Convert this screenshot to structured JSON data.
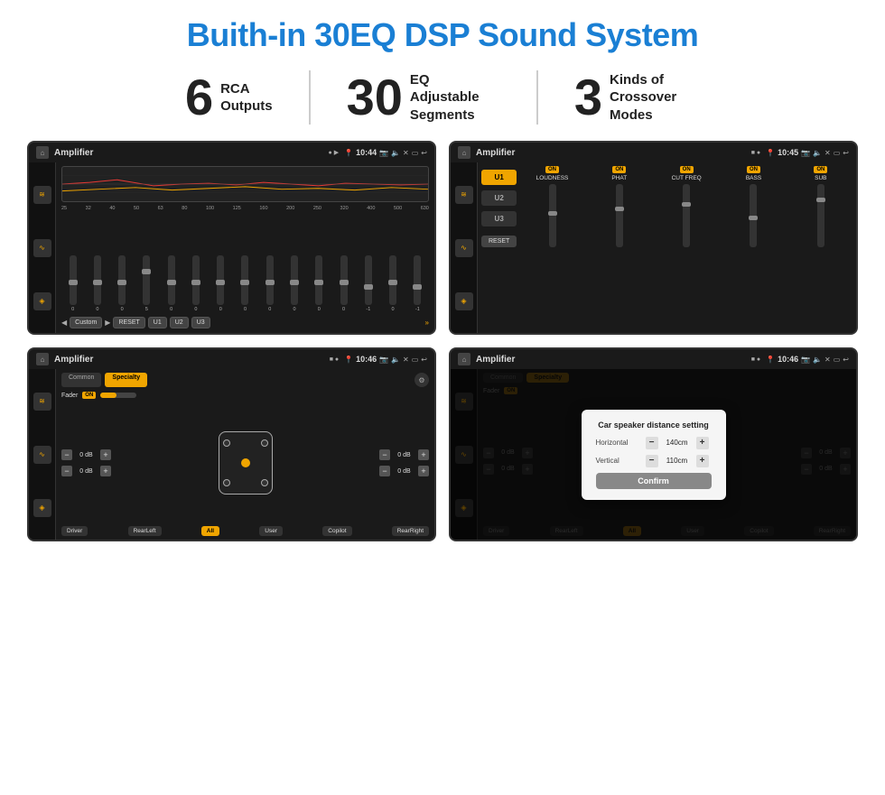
{
  "page": {
    "title": "Buith-in 30EQ DSP Sound System",
    "stats": [
      {
        "number": "6",
        "text": "RCA\nOutputs"
      },
      {
        "number": "30",
        "text": "EQ Adjustable\nSegments"
      },
      {
        "number": "3",
        "text": "Kinds of\nCrossover Modes"
      }
    ]
  },
  "screens": {
    "screen1": {
      "status": {
        "title": "Amplifier",
        "time": "10:44"
      },
      "eq_frequencies": [
        "25",
        "32",
        "40",
        "50",
        "63",
        "80",
        "100",
        "125",
        "160",
        "200",
        "250",
        "320",
        "400",
        "500",
        "630"
      ],
      "eq_values": [
        "0",
        "0",
        "0",
        "5",
        "0",
        "0",
        "0",
        "0",
        "0",
        "0",
        "0",
        "0",
        "-1",
        "0",
        "-1"
      ],
      "bottom_buttons": [
        "Custom",
        "RESET",
        "U1",
        "U2",
        "U3"
      ]
    },
    "screen2": {
      "status": {
        "title": "Amplifier",
        "time": "10:45"
      },
      "u_buttons": [
        "U1",
        "U2",
        "U3"
      ],
      "controls": [
        "LOUDNESS",
        "PHAT",
        "CUT FREQ",
        "BASS",
        "SUB"
      ],
      "reset": "RESET"
    },
    "screen3": {
      "status": {
        "title": "Amplifier",
        "time": "10:46"
      },
      "tabs": [
        "Common",
        "Specialty"
      ],
      "fader_label": "Fader",
      "bottom_buttons": [
        "Driver",
        "RearLeft",
        "All",
        "User",
        "Copilot",
        "RearRight"
      ]
    },
    "screen4": {
      "status": {
        "title": "Amplifier",
        "time": "10:46"
      },
      "tabs": [
        "Common",
        "Specialty"
      ],
      "modal": {
        "title": "Car speaker distance setting",
        "horizontal_label": "Horizontal",
        "horizontal_value": "140cm",
        "vertical_label": "Vertical",
        "vertical_value": "110cm",
        "confirm": "Confirm"
      },
      "bottom_buttons": [
        "Driver",
        "RearLeft",
        "All",
        "User",
        "Copilot",
        "RearRight"
      ]
    }
  },
  "icons": {
    "home": "⌂",
    "location": "📍",
    "sound": "♪",
    "back": "↩",
    "camera": "📷",
    "eq_icon": "≋",
    "wave_icon": "∿",
    "speaker_icon": "🔊",
    "minus": "−",
    "plus": "+"
  }
}
